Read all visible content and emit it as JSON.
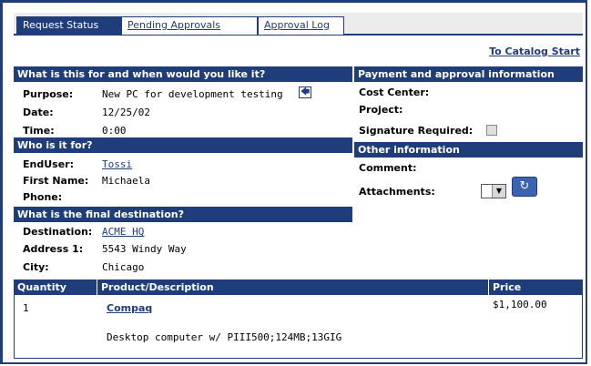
{
  "tabs": [
    {
      "label": "Request Status",
      "active": true
    },
    {
      "label": "Pending Approvals",
      "active": false
    },
    {
      "label": "Approval Log",
      "active": false
    }
  ],
  "catalog_link": "To Catalog Start",
  "purpose_section": {
    "header": "What is this for and when would you like it?",
    "purpose_label": "Purpose:",
    "purpose_value": "New PC for development testing",
    "date_label": "Date:",
    "date_value": "12/25/02",
    "time_label": "Time:",
    "time_value": "0:00"
  },
  "who_section": {
    "header": "Who is it for?",
    "enduser_label": "EndUser:",
    "enduser_value": "Tossi",
    "firstname_label": "First Name:",
    "firstname_value": "Michaela",
    "phone_label": "Phone:"
  },
  "destination_section": {
    "header": "What is the final destination?",
    "destination_label": "Destination:",
    "destination_value": "ACME HQ",
    "address_label": "Address 1:",
    "address_value": "5543 Windy Way",
    "city_label": "City:",
    "city_value": "Chicago"
  },
  "payment_section": {
    "header": "Payment and approval information",
    "cost_center_label": "Cost Center:",
    "project_label": "Project:",
    "signature_label": "Signature Required:",
    "signature_checked": false
  },
  "other_section": {
    "header": "Other information",
    "comment_label": "Comment:",
    "attachments_label": "Attachments:"
  },
  "items_table": {
    "columns": [
      "Quantity",
      "Product/Description",
      "Price"
    ],
    "rows": [
      {
        "quantity": "1",
        "product": "Compaq",
        "description": "Desktop computer w/ PIII500;124MB;13GIG",
        "price": "$1,100.00"
      }
    ]
  },
  "colors": {
    "header_bg": "#1f3d7a",
    "tab_bg": "#ececec",
    "link": "#1f3d7a"
  },
  "icons": [
    "left-arrow-icon",
    "attachment-icon",
    "dropdown-arrow-icon"
  ]
}
